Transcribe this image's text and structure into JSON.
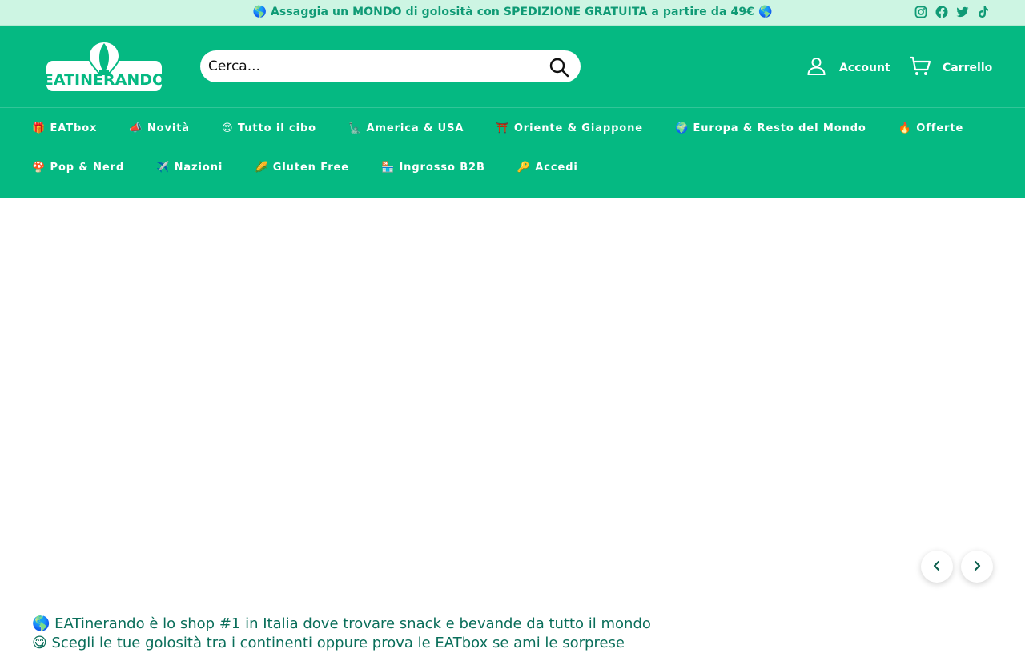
{
  "announcement": {
    "text": "🌎 Assaggia un MONDO di golosità con SPEDIZIONE GRATUITA a partire da 49€ 🌎"
  },
  "socials": [
    {
      "icon": "instagram-icon"
    },
    {
      "icon": "facebook-icon"
    },
    {
      "icon": "twitter-icon"
    },
    {
      "icon": "tiktok-icon"
    }
  ],
  "header": {
    "logo_text": "EATINERANDO",
    "search_placeholder": "Cerca...",
    "account_label": "Account",
    "cart_label": "Carrello"
  },
  "nav": {
    "row1": [
      {
        "label": "🎁 EATbox"
      },
      {
        "label": "📣 Novità"
      },
      {
        "label": "😍 Tutto il cibo"
      },
      {
        "label": "🗽 America & USA"
      },
      {
        "label": "⛩️ Oriente & Giappone"
      },
      {
        "label": "🌍 Europa & Resto del Mondo"
      },
      {
        "label": "🔥 Offerte"
      }
    ],
    "row2": [
      {
        "label": "🍄 Pop & Nerd"
      },
      {
        "label": "✈️ Nazioni"
      },
      {
        "label": "🌽 Gluten Free"
      },
      {
        "label": "🏪 Ingrosso B2B"
      },
      {
        "label": "🔑 Accedi"
      }
    ]
  },
  "intro": {
    "line1": "🌎 EATinerando è lo shop #1 in Italia dove trovare snack e bevande da tutto il mondo",
    "line2": "😋 Scegli le tue golosità tra i continenti oppure prova le EATbox se ami le sorprese"
  },
  "colors": {
    "brand_green": "#05b982",
    "announce_bg": "#cdf5e3",
    "announce_text": "#0f9a75",
    "intro_text": "#0a6e5a"
  }
}
